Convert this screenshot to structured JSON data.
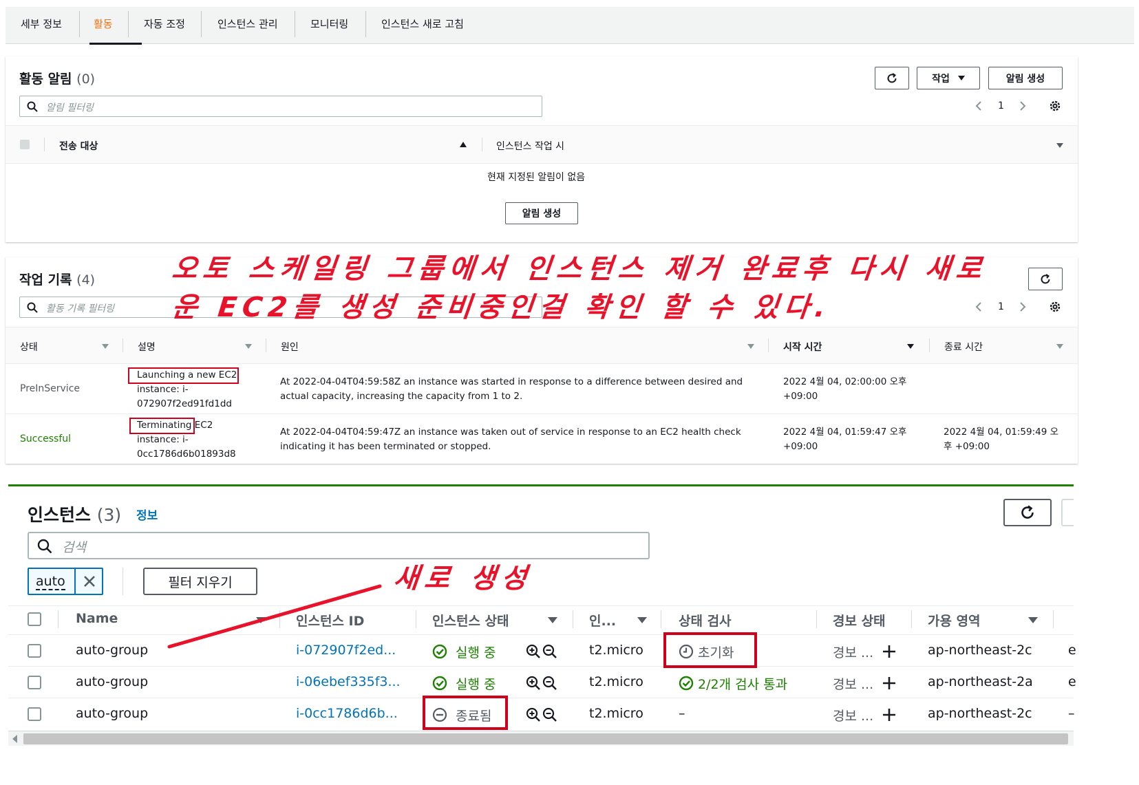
{
  "tabs": [
    "세부 정보",
    "활동",
    "자동 조정",
    "인스턴스 관리",
    "모니터링",
    "인스턴스 새로 고침"
  ],
  "alerts": {
    "title": "활동 알림",
    "count": "(0)",
    "action_label": "작업",
    "create_label": "알림 생성",
    "filter_placeholder": "알림 필터링",
    "page": "1",
    "col_target": "전송 대상",
    "col_instance_action": "인스턴스 작업 시",
    "empty_text": "현재 지정된 알림이 없음",
    "empty_button": "알림 생성"
  },
  "history": {
    "title": "작업 기록",
    "count": "(4)",
    "filter_placeholder": "활동 기록 필터링",
    "page": "1",
    "columns": [
      "상태",
      "설명",
      "원인",
      "시작 시간",
      "종료 시간"
    ],
    "rows": [
      {
        "status": "PreInService",
        "desc1": "Launching a new EC2",
        "desc2": "instance: i-",
        "desc3": "072907f2ed91fd1dd",
        "cause1": "At 2022-04-04T04:59:58Z an instance was started in response to a difference between desired and",
        "cause2": "actual capacity, increasing the capacity from 1 to 2.",
        "start1": "2022 4월 04, 02:00:00 오후",
        "start2": "+09:00",
        "end1": "",
        "end2": ""
      },
      {
        "status": "Successful",
        "desc1": "Terminating EC2",
        "desc2": "instance: i-",
        "desc3": "0cc1786d6b01893d8",
        "cause1": "At 2022-04-04T04:59:47Z an instance was taken out of service in response to an EC2 health check",
        "cause2": "indicating it has been terminated or stopped.",
        "start1": "2022 4월 04, 01:59:47 오후",
        "start2": "+09:00",
        "end1": "2022 4월 04, 01:59:49 오",
        "end2": "후 +09:00"
      }
    ]
  },
  "annotation_top_line1": "오토 스케일링 그룹에서 인스턴스 제거 완료후 다시 새로",
  "annotation_top_line2": "운 EC2를 생성 준비중인걸 확인 할 수 있다.",
  "annotation_new": "새로 생성",
  "instances": {
    "title": "인스턴스",
    "count": "(3)",
    "info": "정보",
    "search_placeholder": "검색",
    "token": "auto",
    "clear_filters": "필터 지우기",
    "columns": [
      "Name",
      "인스턴스 ID",
      "인스턴스 상태",
      "인...",
      "상태 검사",
      "경보 상태",
      "가용 영역"
    ],
    "rows": [
      {
        "name": "auto-group",
        "id": "i-072907f2ed...",
        "state": "실행 중",
        "type": "t2.micro",
        "check": "초기화",
        "alarm": "경보 ...",
        "az": "ap-northeast-2c",
        "extra": "e"
      },
      {
        "name": "auto-group",
        "id": "i-06ebef335f3...",
        "state": "실행 중",
        "type": "t2.micro",
        "check": "2/2개 검사 통과",
        "alarm": "경보 ...",
        "az": "ap-northeast-2a",
        "extra": "e"
      },
      {
        "name": "auto-group",
        "id": "i-0cc1786d6b...",
        "state": "종료됨",
        "type": "t2.micro",
        "check": "–",
        "alarm": "경보 ...",
        "az": "ap-northeast-2c",
        "extra": "–"
      }
    ]
  },
  "colors": {
    "accent_orange": "#ec7211",
    "link_blue": "#0073bb",
    "success_green": "#1d8102",
    "annotation_red": "#e8132a"
  }
}
